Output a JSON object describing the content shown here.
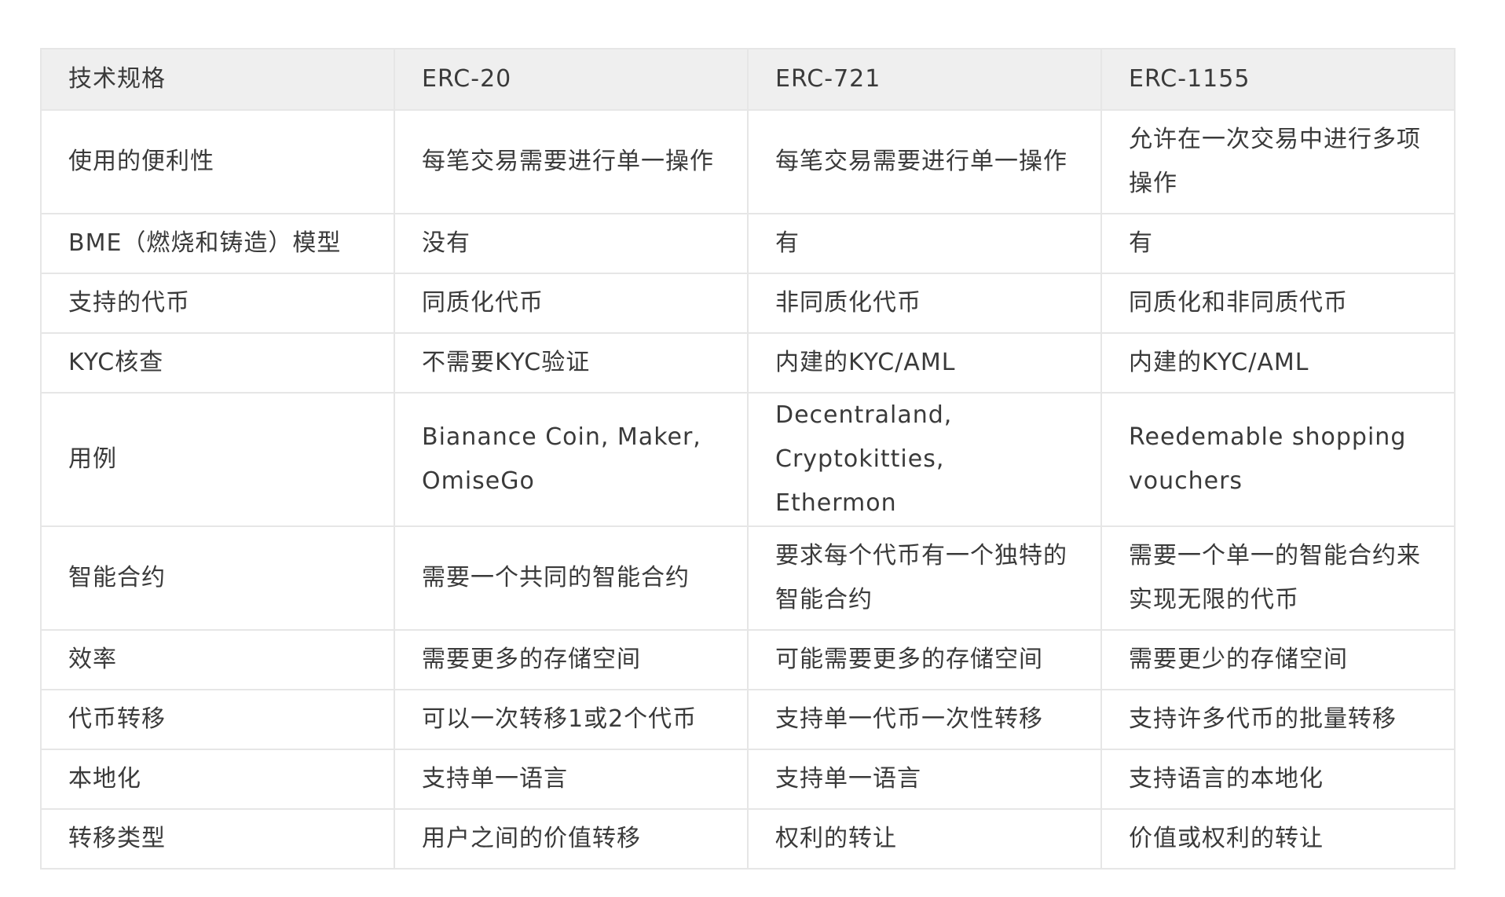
{
  "table": {
    "headers": [
      "技术规格",
      "ERC-20",
      "ERC-721",
      "ERC-1155"
    ],
    "rows": [
      {
        "tall": true,
        "cells": [
          "使用的便利性",
          "每笔交易需要进行单一操作",
          "每笔交易需要进行单一操作",
          "允许在一次交易中进行多项操作"
        ]
      },
      {
        "tall": false,
        "cells": [
          "BME（燃烧和铸造）模型",
          "没有",
          "有",
          "有"
        ]
      },
      {
        "tall": false,
        "cells": [
          "支持的代币",
          "同质化代币",
          "非同质化代币",
          "同质化和非同质代币"
        ]
      },
      {
        "tall": false,
        "cells": [
          "KYC核查",
          "不需要KYC验证",
          "内建的KYC/AML",
          "内建的KYC/AML"
        ]
      },
      {
        "tall": true,
        "cells": [
          "用例",
          "Bianance Coin, Maker, OmiseGo",
          "Decentraland, Cryptokitties, Ethermon",
          "Reedemable shopping vouchers"
        ]
      },
      {
        "tall": true,
        "cells": [
          "智能合约",
          "需要一个共同的智能合约",
          "要求每个代币有一个独特的智能合约",
          "需要一个单一的智能合约来实现无限的代币"
        ]
      },
      {
        "tall": false,
        "cells": [
          "效率",
          "需要更多的存储空间",
          "可能需要更多的存储空间",
          "需要更少的存储空间"
        ]
      },
      {
        "tall": false,
        "cells": [
          "代币转移",
          "可以一次转移1或2个代币",
          "支持单一代币一次性转移",
          "支持许多代币的批量转移"
        ]
      },
      {
        "tall": false,
        "cells": [
          "本地化",
          "支持单一语言",
          "支持单一语言",
          "支持语言的本地化"
        ]
      },
      {
        "tall": false,
        "cells": [
          "转移类型",
          "用户之间的价值转移",
          "权利的转让",
          "价值或权利的转让"
        ]
      }
    ]
  }
}
